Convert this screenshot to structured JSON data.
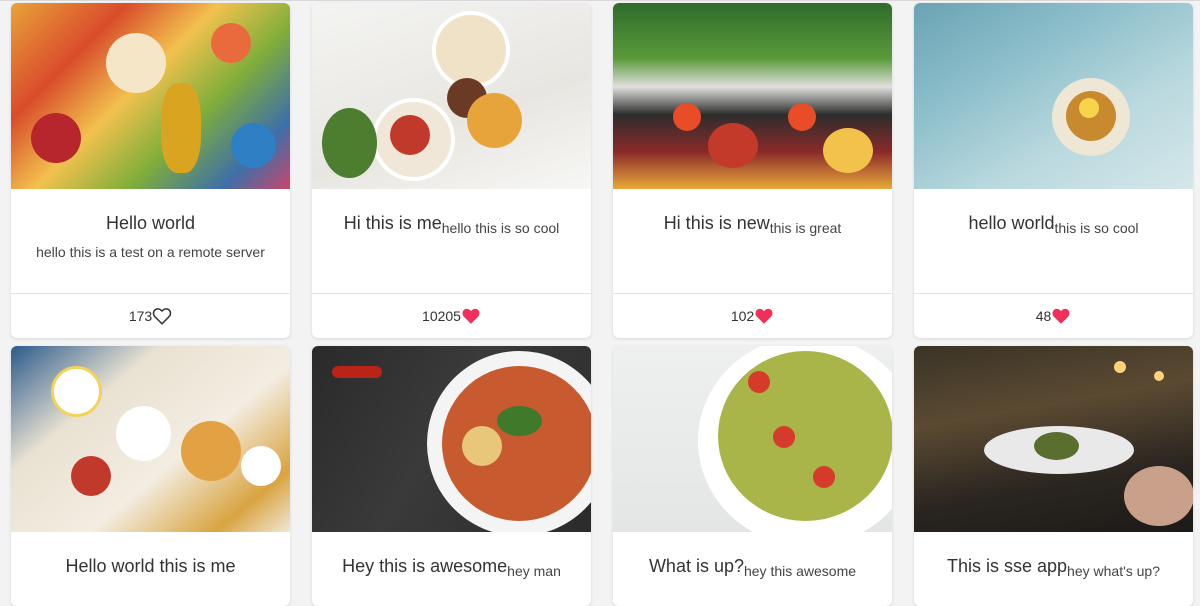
{
  "cards": [
    {
      "title": "Hello world",
      "subtitle": "",
      "description": "hello this is a test on a remote server",
      "likes": "173",
      "liked": false,
      "image_icon": "food-flatlay-image"
    },
    {
      "title": "Hi this is me",
      "subtitle": "hello this is so cool",
      "description": "",
      "likes": "10205",
      "liked": true,
      "image_icon": "breakfast-table-image"
    },
    {
      "title": "Hi this is new",
      "subtitle": "this is great",
      "description": "",
      "likes": "102",
      "liked": true,
      "image_icon": "salad-bar-image"
    },
    {
      "title": "hello world",
      "subtitle": "this is so cool",
      "description": "",
      "likes": "48",
      "liked": true,
      "image_icon": "plated-dish-image"
    },
    {
      "title": "Hello world this is me",
      "subtitle": "",
      "description": "",
      "likes": "",
      "liked": false,
      "image_icon": "brunch-spread-image"
    },
    {
      "title": "Hey this is awesome",
      "subtitle": "hey man",
      "description": "",
      "likes": "",
      "liked": false,
      "image_icon": "curry-bowl-image"
    },
    {
      "title": "What is up?",
      "subtitle": "hey this awesome",
      "description": "",
      "likes": "",
      "liked": false,
      "image_icon": "pasta-salad-image"
    },
    {
      "title": "This is sse app",
      "subtitle": "hey what's up?",
      "description": "",
      "likes": "",
      "liked": false,
      "image_icon": "restaurant-dinner-image"
    }
  ],
  "colors": {
    "heart_filled": "#f0305a",
    "heart_outline": "#333333",
    "card_bg": "#ffffff",
    "page_bg": "#f3f3f3"
  }
}
